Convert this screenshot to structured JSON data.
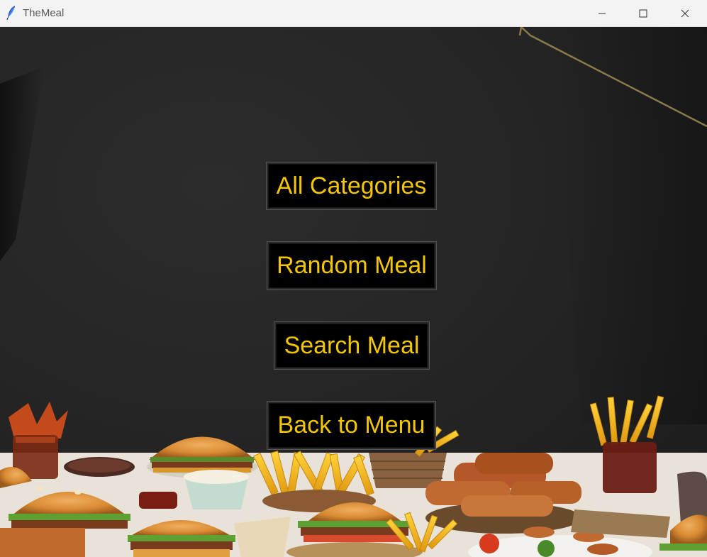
{
  "window": {
    "title": "TheMeal",
    "app_icon": "feather-icon",
    "controls": {
      "minimize_icon": "minimize-icon",
      "maximize_icon": "maximize-icon",
      "close_icon": "close-icon"
    }
  },
  "menu": {
    "buttons": [
      {
        "label": "All Categories"
      },
      {
        "label": "Random Meal"
      },
      {
        "label": "Search Meal"
      },
      {
        "label": "Back to Menu"
      }
    ]
  },
  "colors": {
    "button_text": "#f3c600",
    "button_bg": "#000000",
    "background": "#252525",
    "titlebar": "#f3f3f3"
  }
}
